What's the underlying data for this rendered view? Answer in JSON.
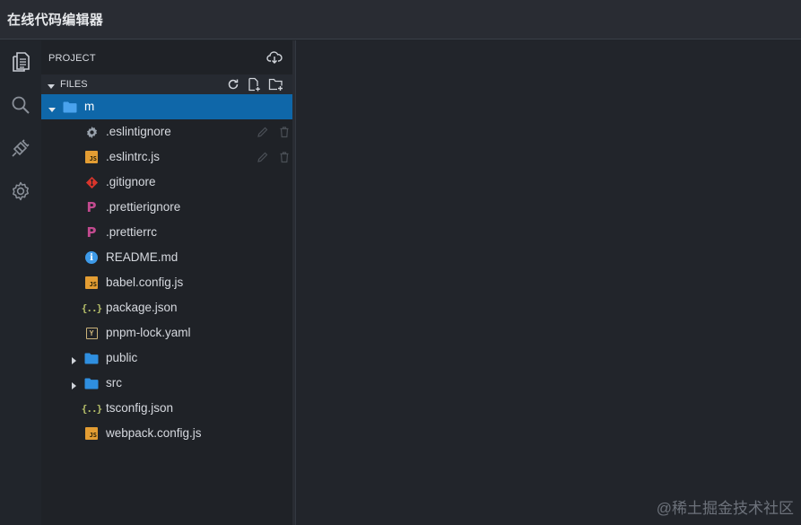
{
  "window": {
    "title": "在线代码编辑器"
  },
  "activity_bar": {
    "icons": [
      "files-icon",
      "search-icon",
      "plug-icon",
      "gear-icon"
    ]
  },
  "sidebar": {
    "project_label": "PROJECT",
    "files_label": "FILES",
    "tree": [
      {
        "name": "m",
        "type": "folder",
        "expanded": true,
        "selected": true,
        "icon": "folder-icon"
      },
      {
        "name": ".eslintignore",
        "type": "file",
        "icon": "gear-icon",
        "show_actions": true
      },
      {
        "name": ".eslintrc.js",
        "type": "file",
        "icon": "js-icon",
        "badge": "JS",
        "show_actions": true
      },
      {
        "name": ".gitignore",
        "type": "file",
        "icon": "git-icon"
      },
      {
        "name": ".prettierignore",
        "type": "file",
        "icon": "prettier-icon",
        "badge": "P"
      },
      {
        "name": ".prettierrc",
        "type": "file",
        "icon": "prettier-icon",
        "badge": "P"
      },
      {
        "name": "README.md",
        "type": "file",
        "icon": "info-icon",
        "badge": "i"
      },
      {
        "name": "babel.config.js",
        "type": "file",
        "icon": "js-icon",
        "badge": "JS"
      },
      {
        "name": "package.json",
        "type": "file",
        "icon": "json-icon",
        "badge": "{..}"
      },
      {
        "name": "pnpm-lock.yaml",
        "type": "file",
        "icon": "yaml-icon",
        "badge": "Y"
      },
      {
        "name": "public",
        "type": "folder",
        "expanded": false,
        "icon": "folder-icon"
      },
      {
        "name": "src",
        "type": "folder",
        "expanded": false,
        "icon": "folder-icon"
      },
      {
        "name": "tsconfig.json",
        "type": "file",
        "icon": "json-icon",
        "badge": "{..}"
      },
      {
        "name": "webpack.config.js",
        "type": "file",
        "icon": "js-icon",
        "badge": "JS"
      }
    ]
  },
  "watermark": "@稀土掘金技术社区",
  "colors": {
    "accent_selection": "#0f67a9",
    "folder": "#2f8fe0",
    "js": "#e39d33",
    "git": "#d8352c",
    "prettier": "#c24a8f",
    "info": "#3d9ae8",
    "json": "#b7c06a",
    "yaml": "#cbb37a"
  }
}
